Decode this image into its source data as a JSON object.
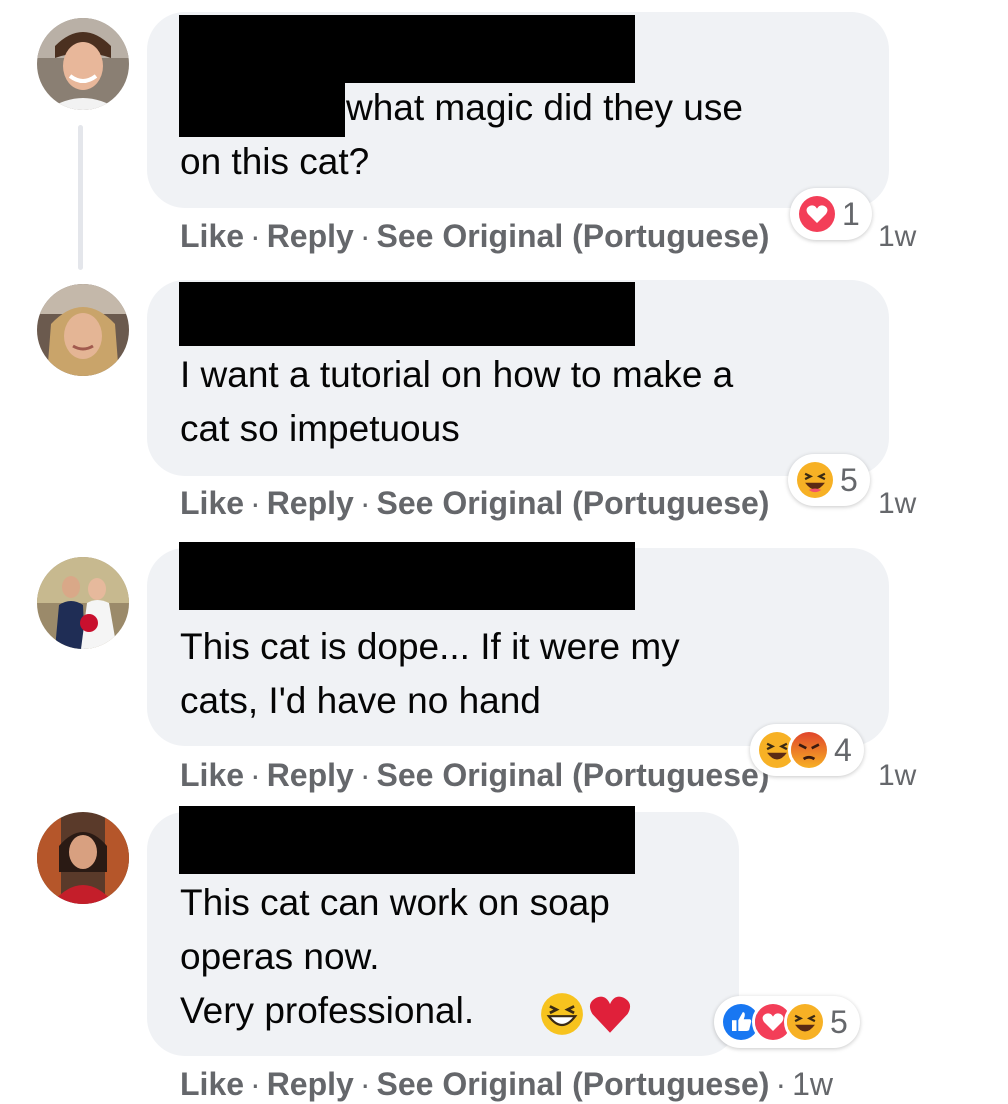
{
  "comments": [
    {
      "text_line1": "what magic did they use",
      "text_line2": "on this cat?",
      "actions": {
        "like": "Like",
        "reply": "Reply",
        "see_original": "See Original (Portuguese)",
        "sep": "·",
        "time": "1w"
      },
      "reactions": {
        "icons": [
          "love-reaction"
        ],
        "count": "1"
      }
    },
    {
      "text_line1": "I want a tutorial on how to make a",
      "text_line2": "cat so impetuous",
      "actions": {
        "like": "Like",
        "reply": "Reply",
        "see_original": "See Original (Portuguese)",
        "sep": "·",
        "time": "1w"
      },
      "reactions": {
        "icons": [
          "haha-reaction"
        ],
        "count": "5"
      }
    },
    {
      "text_line1": "This cat is dope... If it were my",
      "text_line2": "cats, I'd have no hand",
      "actions": {
        "like": "Like",
        "reply": "Reply",
        "see_original": "See Original (Portuguese)",
        "sep": "·",
        "time": "1w"
      },
      "reactions": {
        "icons": [
          "haha-reaction",
          "angry-reaction"
        ],
        "count": "4"
      }
    },
    {
      "text_line1": "This cat can work on soap",
      "text_line2": "operas now.",
      "text_line3": "Very professional.",
      "inline_emojis": [
        "laughing-emoji",
        "red-heart-emoji"
      ],
      "actions": {
        "like": "Like",
        "reply": "Reply",
        "see_original": "See Original (Portuguese)",
        "sep": "·",
        "time": "1w"
      },
      "reactions": {
        "icons": [
          "like-reaction",
          "love-reaction",
          "haha-reaction"
        ],
        "count": "5"
      }
    }
  ],
  "colors": {
    "bubble": "#f0f2f5",
    "action_text": "#65676b",
    "like_blue": "#1877f2",
    "love_red": "#f33e58",
    "haha_yellow": "#f7b125",
    "angry_orange": "#e9710f",
    "redaction": "#000000"
  }
}
